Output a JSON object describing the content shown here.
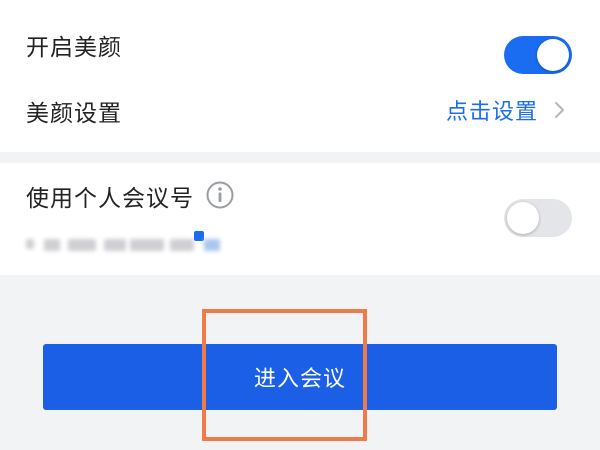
{
  "settings": {
    "beauty": {
      "label": "开启美颜",
      "enabled": true
    },
    "beauty_settings": {
      "label": "美颜设置",
      "action_label": "点击设置"
    },
    "personal_meeting_id": {
      "label": "使用个人会议号",
      "enabled": false,
      "number_masked": true
    }
  },
  "actions": {
    "enter_meeting_label": "进入会议"
  },
  "colors": {
    "accent": "#1a6cf0",
    "button": "#1a5fe6",
    "highlight": "#f07a4a",
    "background": "#f2f3f5"
  },
  "icons": {
    "info": "info-icon",
    "chevron": "chevron-right-icon"
  }
}
